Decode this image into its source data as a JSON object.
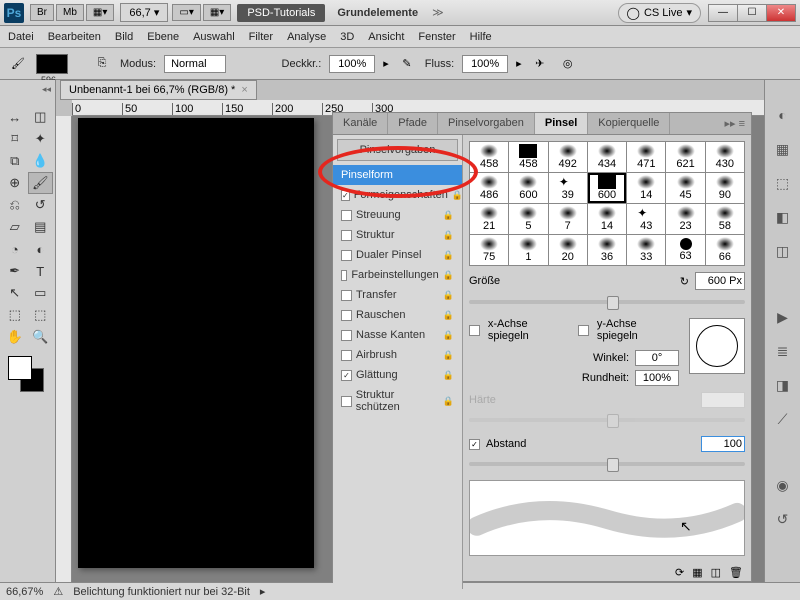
{
  "titlebar": {
    "ps": "Ps",
    "btns": [
      "Br",
      "Mb"
    ],
    "zoom": "66,7",
    "psd_tut": "PSD-Tutorials",
    "grund": "Grundelemente",
    "cslive": "CS Live"
  },
  "menu": [
    "Datei",
    "Bearbeiten",
    "Bild",
    "Ebene",
    "Auswahl",
    "Filter",
    "Analyse",
    "3D",
    "Ansicht",
    "Fenster",
    "Hilfe"
  ],
  "optbar": {
    "swatch": "596",
    "modus_lbl": "Modus:",
    "modus_val": "Normal",
    "deck_lbl": "Deckkr.:",
    "deck_val": "100%",
    "fluss_lbl": "Fluss:",
    "fluss_val": "100%"
  },
  "doc": {
    "tab": "Unbenannt-1 bei 66,7% (RGB/8) *"
  },
  "ruler_ticks": [
    "0",
    "50",
    "100",
    "150",
    "200",
    "250",
    "300"
  ],
  "panel": {
    "tabs": [
      "Kanäle",
      "Pfade",
      "Pinselvorgaben",
      "Pinsel",
      "Kopierquelle"
    ],
    "active": 3,
    "options_hdr": "Pinselvorgaben",
    "options": [
      {
        "label": "Pinselform",
        "checked": null,
        "selected": true
      },
      {
        "label": "Formeigenschaften",
        "checked": true,
        "lock": true
      },
      {
        "label": "Streuung",
        "checked": false,
        "lock": true
      },
      {
        "label": "Struktur",
        "checked": false,
        "lock": true
      },
      {
        "label": "Dualer Pinsel",
        "checked": false,
        "lock": true
      },
      {
        "label": "Farbeinstellungen",
        "checked": false,
        "lock": true
      },
      {
        "label": "Transfer",
        "checked": false,
        "lock": true
      },
      {
        "label": "Rauschen",
        "checked": false,
        "lock": true
      },
      {
        "label": "Nasse Kanten",
        "checked": false,
        "lock": true
      },
      {
        "label": "Airbrush",
        "checked": false,
        "lock": true
      },
      {
        "label": "Glättung",
        "checked": true,
        "lock": true
      },
      {
        "label": "Struktur schützen",
        "checked": false,
        "lock": true
      }
    ],
    "brush_sizes_r1": [
      "458",
      "458",
      "492",
      "434",
      "471",
      "621",
      "430"
    ],
    "brush_sizes_r2": [
      "486",
      "600",
      "39",
      "600",
      "14",
      "45",
      "90"
    ],
    "brush_sizes_r3": [
      "21",
      "5",
      "7",
      "14",
      "43",
      "23",
      "58"
    ],
    "brush_sizes_r4": [
      "75",
      "1",
      "20",
      "36",
      "33",
      "63",
      "66"
    ],
    "size_lbl": "Größe",
    "size_val": "600 Px",
    "x_mirror": "x-Achse spiegeln",
    "y_mirror": "y-Achse spiegeln",
    "winkel_lbl": "Winkel:",
    "winkel_val": "0°",
    "rund_lbl": "Rundheit:",
    "rund_val": "100%",
    "haerte_lbl": "Härte",
    "abst_lbl": "Abstand",
    "abst_val": "100"
  },
  "status": {
    "zoom": "66,67%",
    "msg": "Belichtung funktioniert nur bei 32-Bit"
  }
}
